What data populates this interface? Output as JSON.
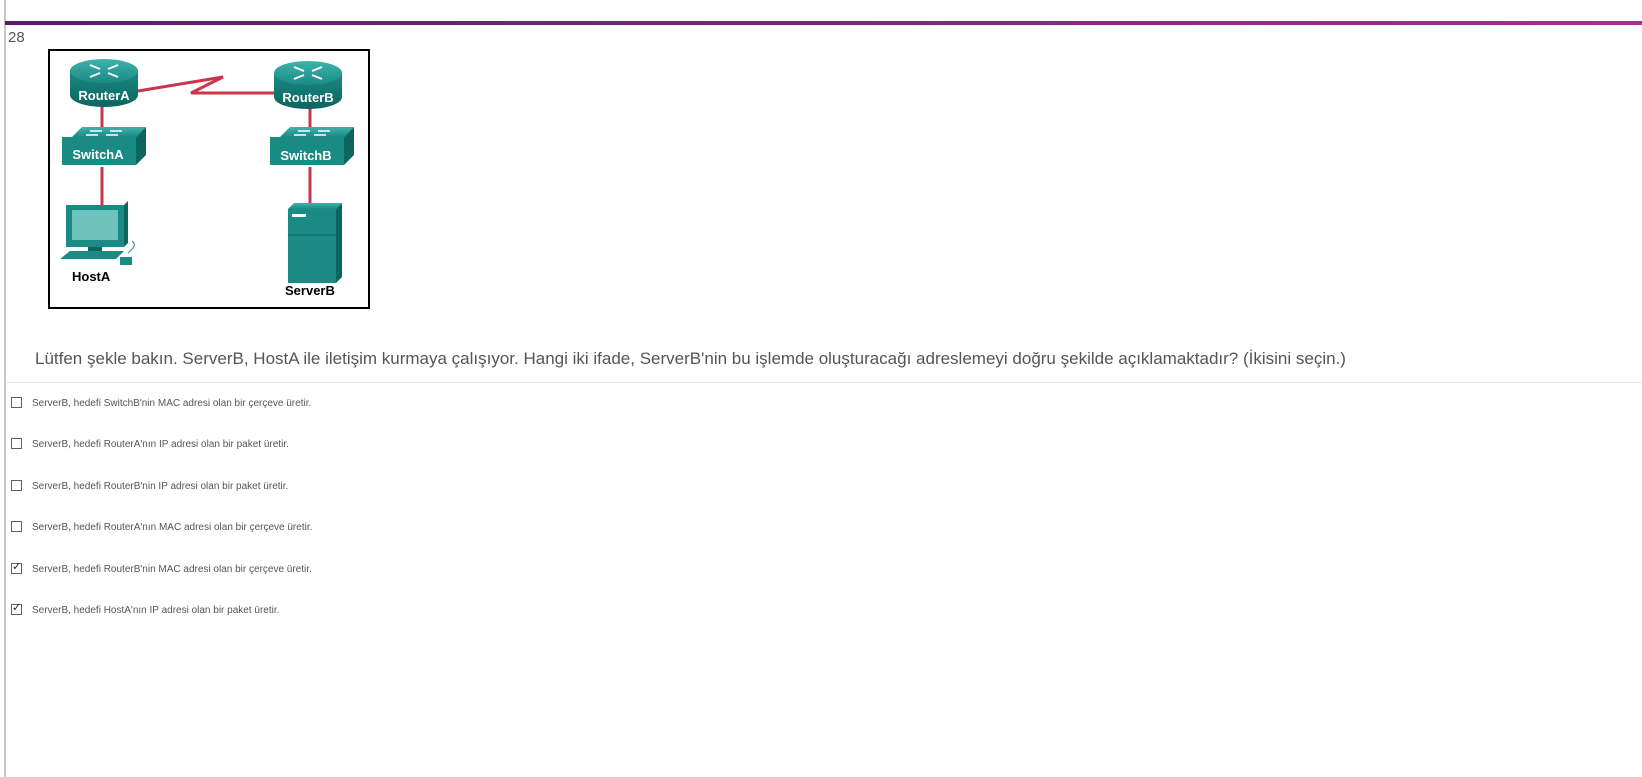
{
  "question": {
    "number": "28",
    "text": "Lütfen şekle bakın. ServerB, HostA ile iletişim kurmaya çalışıyor. Hangi iki ifade, ServerB'nin bu işlemde oluşturacağı adreslemeyi doğru şekilde açıklamaktadır? (İkisini seçin.)"
  },
  "figure": {
    "router_a_label": "RouterA",
    "router_b_label": "RouterB",
    "switch_a_label": "SwitchA",
    "switch_b_label": "SwitchB",
    "host_a_label": "HostA",
    "server_b_label": "ServerB",
    "device_color": "#1a8a84",
    "link_color": "#c9354a"
  },
  "options": [
    {
      "label": "ServerB, hedefi SwitchB'nin MAC adresi olan bir çerçeve üretir.",
      "checked": false
    },
    {
      "label": "ServerB, hedefi RouterA'nın IP adresi olan bir paket üretir.",
      "checked": false
    },
    {
      "label": "ServerB, hedefi RouterB'nin IP adresi olan bir paket üretir.",
      "checked": false
    },
    {
      "label": "ServerB, hedefi RouterA'nın MAC adresi olan bir çerçeve üretir.",
      "checked": false
    },
    {
      "label": "ServerB, hedefi RouterB'nin MAC adresi olan bir çerçeve üretir.",
      "checked": true
    },
    {
      "label": "ServerB, hedefi HostA'nın IP adresi olan bir paket üretir.",
      "checked": true
    }
  ],
  "check_glyph": "✓",
  "accent_bar_color": "#7a2680"
}
